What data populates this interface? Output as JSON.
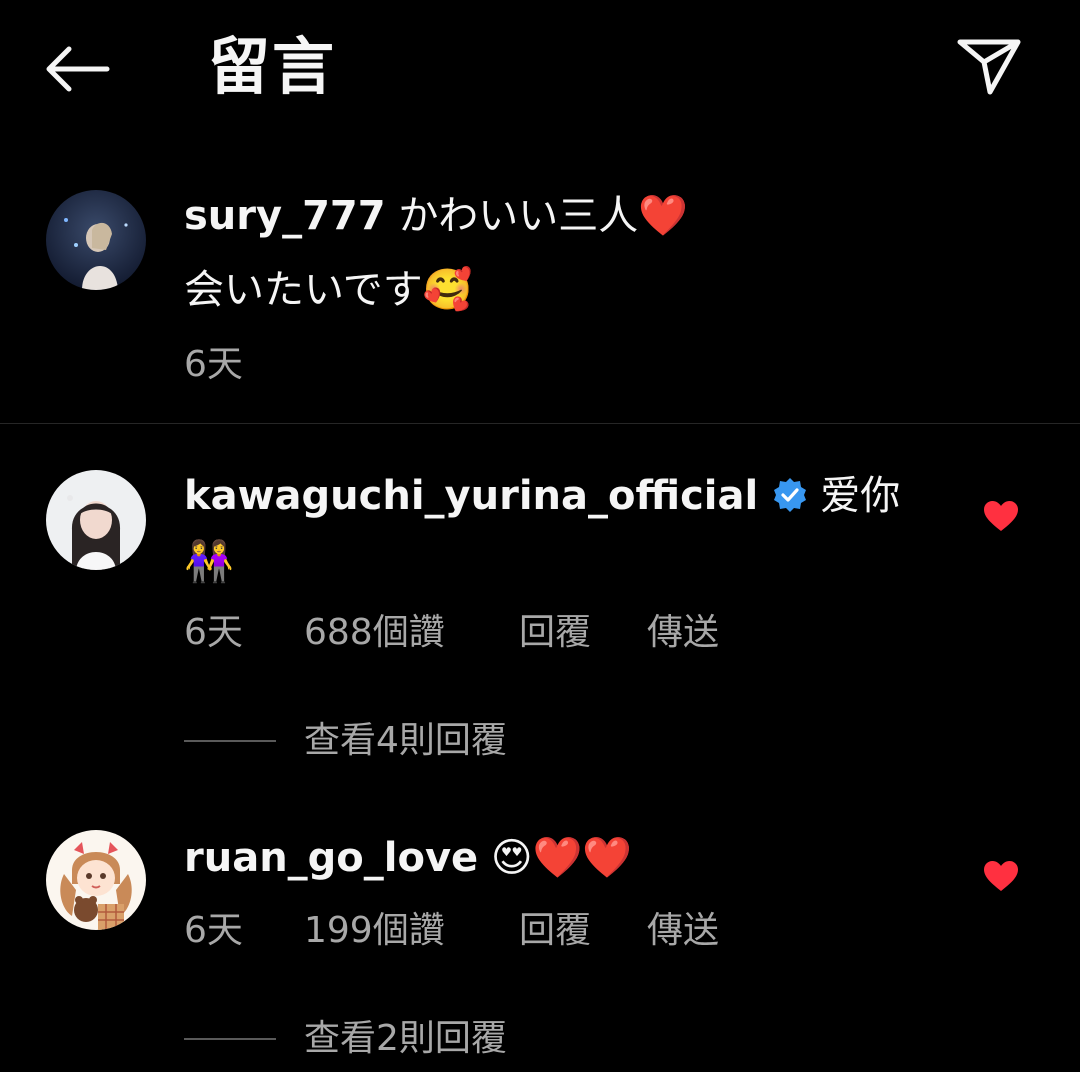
{
  "header": {
    "title": "留言"
  },
  "comments": [
    {
      "username": "sury_777",
      "text_line1": "かわいい三人❤️",
      "text_line2": "会いたいです🥰",
      "time": "6天"
    },
    {
      "username": "kawaguchi_yurina_official",
      "verified": true,
      "text_line1": "爱你",
      "text_line2": "👭",
      "time": "6天",
      "likes": "688個讚",
      "reply": "回覆",
      "send": "傳送",
      "view_replies": "查看4則回覆"
    },
    {
      "username": "ruan_go_love",
      "text_line1": "😍❤️❤️",
      "time": "6天",
      "likes": "199個讚",
      "reply": "回覆",
      "send": "傳送",
      "view_replies": "查看2則回覆"
    }
  ],
  "colors": {
    "background": "#000000",
    "text": "#f5f5f5",
    "muted": "#a8a8a8",
    "like_red": "#ff3040",
    "verified_blue": "#3897f0"
  }
}
